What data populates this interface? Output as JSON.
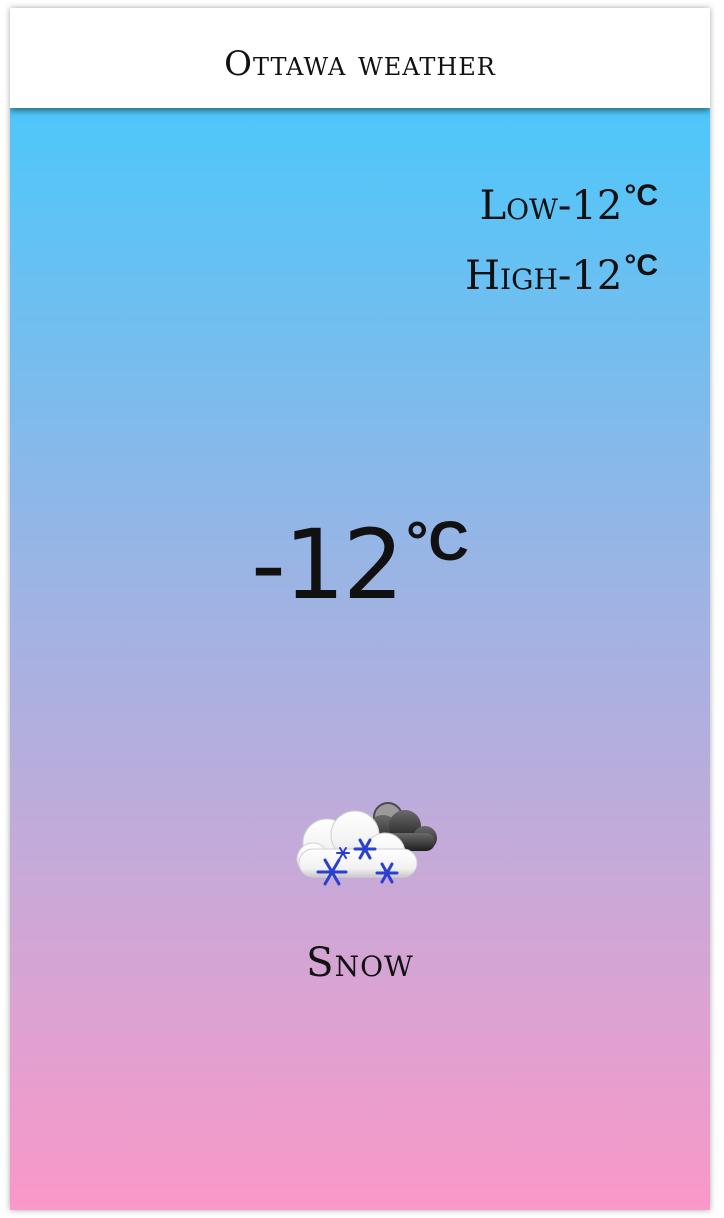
{
  "header": {
    "title": "Ottawa weather"
  },
  "range": {
    "low_label": "Low",
    "low_value": "-12",
    "high_label": "High",
    "high_value": "-12",
    "unit": "°C"
  },
  "current": {
    "temperature": "-12",
    "unit": "°C"
  },
  "condition": {
    "text": "Snow",
    "icon": "snow-cloud-icon"
  },
  "colors": {
    "gradient_top": "#4dc7fa",
    "gradient_bottom": "#fa98c8",
    "header_bg": "#ffffff"
  }
}
